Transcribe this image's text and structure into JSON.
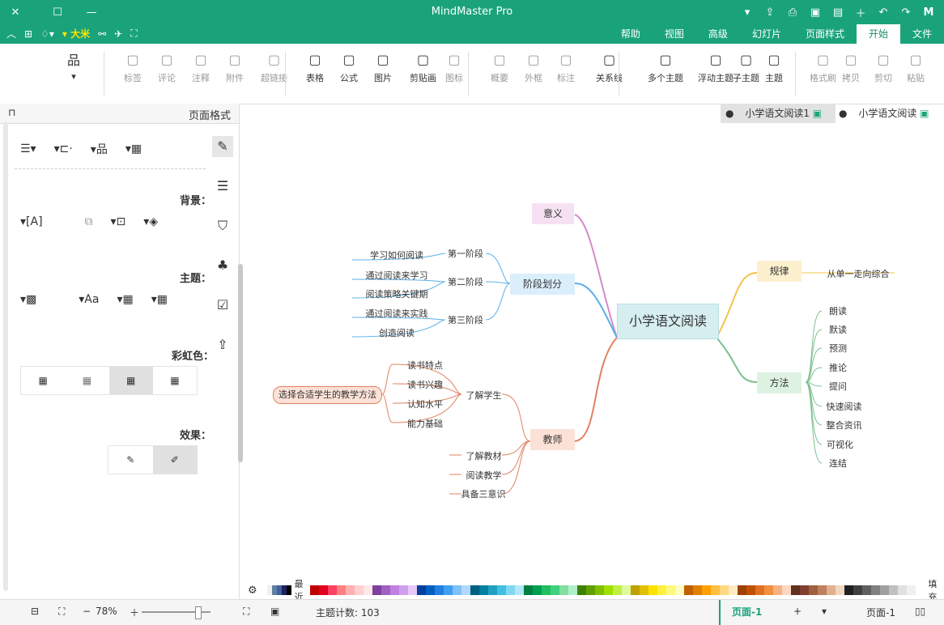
{
  "app": {
    "title": "MindMaster Pro"
  },
  "menu": {
    "tabs": [
      "文件",
      "开始",
      "页面样式",
      "幻灯片",
      "高级",
      "视图",
      "帮助"
    ],
    "active_tab": "开始",
    "left_label": "大米"
  },
  "toolbar": {
    "items": [
      {
        "label": "粘贴",
        "icon": "clipboard-icon",
        "dim": true
      },
      {
        "label": "剪切",
        "icon": "scissors-icon",
        "dim": true
      },
      {
        "label": "拷贝",
        "icon": "copy-icon",
        "dim": true
      },
      {
        "label": "格式刷",
        "icon": "format-brush-icon",
        "dim": true
      },
      {
        "label": "主题",
        "icon": "topic-icon",
        "dim": false
      },
      {
        "label": "子主题",
        "icon": "subtopic-icon",
        "dim": false
      },
      {
        "label": "浮动主题",
        "icon": "floating-topic-icon",
        "dim": false
      },
      {
        "label": "多个主题",
        "icon": "multiple-topics-icon",
        "dim": false
      },
      {
        "label": "关系线",
        "icon": "relationship-icon",
        "dim": false
      },
      {
        "label": "标注",
        "icon": "callout-icon",
        "dim": true
      },
      {
        "label": "外框",
        "icon": "boundary-icon",
        "dim": true
      },
      {
        "label": "概要",
        "icon": "summary-icon",
        "dim": true
      },
      {
        "label": "图标",
        "icon": "mark-icon",
        "dim": true
      },
      {
        "label": "剪贴画",
        "icon": "clipart-icon",
        "dim": false
      },
      {
        "label": "图片",
        "icon": "image-icon",
        "dim": false
      },
      {
        "label": "公式",
        "icon": "formula-icon",
        "dim": false
      },
      {
        "label": "表格",
        "icon": "table-icon",
        "dim": false
      },
      {
        "label": "超链接",
        "icon": "hyperlink-icon",
        "dim": true
      },
      {
        "label": "附件",
        "icon": "attachment-icon",
        "dim": true
      },
      {
        "label": "注释",
        "icon": "note-icon",
        "dim": true
      },
      {
        "label": "评论",
        "icon": "comment-icon",
        "dim": true
      },
      {
        "label": "标签",
        "icon": "tag-icon",
        "dim": true
      }
    ]
  },
  "left_panel": {
    "title": "页面格式",
    "sections": {
      "background": "背景：",
      "theme": "主题：",
      "rainbow": "彩虹色：",
      "effect": "效果："
    }
  },
  "doc_tabs": [
    {
      "label": "小学语文阅读",
      "active": false
    },
    {
      "label": "小学语文阅读1",
      "active": true
    }
  ],
  "mindmap": {
    "center": "小学语文阅读",
    "branches": {
      "meaning": "意义",
      "stage": "阶段划分",
      "teacher": "教师",
      "rule": "规律",
      "method": "方法"
    },
    "stage_items": [
      "第一阶段",
      "第二阶段",
      "第三阶段"
    ],
    "stage_leaves": [
      "学习如何阅读",
      "通过阅读来学习",
      "阅读策略关键期",
      "通过阅读来实践",
      "创造阅读"
    ],
    "teacher_items": [
      "了解学生",
      "了解教材",
      "阅读教学",
      "具备三意识"
    ],
    "teacher_student_leaves": [
      "读书特点",
      "读书兴趣",
      "认知水平",
      "能力基础"
    ],
    "teacher_summary": "选择合适学生的教学方法",
    "rule_leaf": "从单一走向综合",
    "method_leaves": [
      "朗读",
      "默读",
      "预测",
      "推论",
      "提问",
      "快速阅读",
      "整合资讯",
      "可视化",
      "连结"
    ]
  },
  "palette": {
    "fill_label": "填充",
    "recent_label": "最近",
    "colors": [
      "#c00000",
      "#e00020",
      "#ff4060",
      "#ff8080",
      "#ffb0b0",
      "#ffd0d0",
      "#ffe8e8",
      "#8040a0",
      "#a060c0",
      "#c080e0",
      "#d0a0f0",
      "#e8c8f8",
      "#0040a0",
      "#0060c0",
      "#2080e0",
      "#40a0f0",
      "#80c0f8",
      "#b0d8fc",
      "#006080",
      "#0080a0",
      "#20a0c0",
      "#40c0e0",
      "#80d8f0",
      "#b0e8f8",
      "#008040",
      "#00a050",
      "#20c060",
      "#40d080",
      "#80e0a0",
      "#b0f0c8",
      "#408000",
      "#60a000",
      "#80c000",
      "#a0e000",
      "#c0f040",
      "#e0f8a0",
      "#c0a000",
      "#e0c000",
      "#ffe000",
      "#fff040",
      "#fff880",
      "#fffcc0",
      "#c06000",
      "#e08000",
      "#ffa000",
      "#ffc040",
      "#ffd880",
      "#ffecc0",
      "#a04000",
      "#c05000",
      "#e07020",
      "#f09040",
      "#f8b080",
      "#fcd8c0",
      "#603020",
      "#804030",
      "#a06040",
      "#c08060",
      "#e0b090",
      "#f0d8c0",
      "#202020",
      "#404040",
      "#606060",
      "#808080",
      "#a0a0a0",
      "#c0c0c0",
      "#e0e0e0",
      "#f0f0f0",
      "#ffffff"
    ],
    "recent_colors": [
      "#ffffff",
      "#f0f0f0",
      "#6080a0",
      "#4060a0",
      "#202060",
      "#000000"
    ]
  },
  "status": {
    "page_label": "页面-1",
    "add_label": "+",
    "active_page": "页面-1",
    "topic_count_label": "主题计数: 103",
    "zoom": "78%"
  }
}
